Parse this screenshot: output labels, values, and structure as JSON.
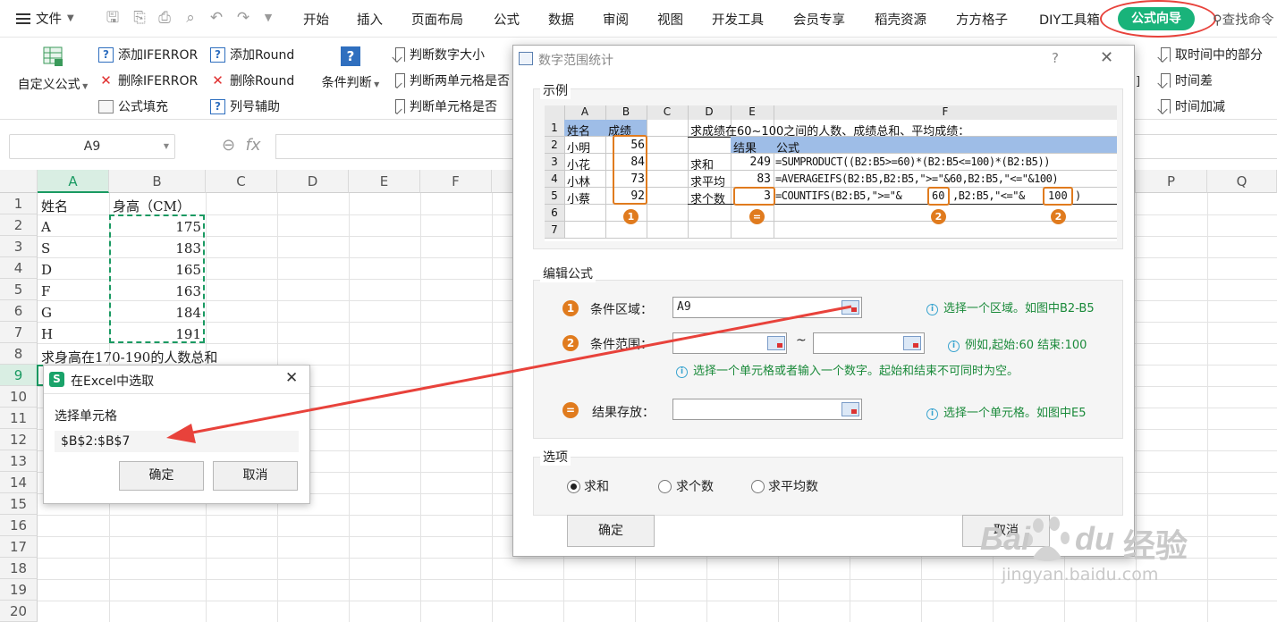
{
  "menubar": {
    "file": "文件",
    "tabs": [
      "开始",
      "插入",
      "页面布局",
      "公式",
      "数据",
      "审阅",
      "视图",
      "开发工具",
      "会员专享",
      "稻壳资源",
      "方方格子",
      "DIY工具箱"
    ],
    "active_tab": "公式向导",
    "search": "查找命令"
  },
  "ribbon": {
    "custom_formula": "自定义公式",
    "add_iferror": "添加IFERROR",
    "del_iferror": "删除IFERROR",
    "formula_fill": "公式填充",
    "add_round": "添加Round",
    "del_round": "删除Round",
    "col_assist": "列号辅助",
    "cond_judge": "条件判断",
    "judge_num": "判断数字大小",
    "judge_two": "判断两单元格是否",
    "judge_cell": "判断单元格是否",
    "time_part": "取时间中的部分",
    "time_diff": "时间差",
    "time_add": "时间加减"
  },
  "formulabar": {
    "namebox": "A9",
    "fx": "fx"
  },
  "sheet": {
    "columns": [
      "A",
      "B",
      "C",
      "D",
      "E",
      "F",
      "G",
      "H",
      "I",
      "J",
      "K",
      "L",
      "M",
      "N",
      "O",
      "P",
      "Q"
    ],
    "rows": [
      "1",
      "2",
      "3",
      "4",
      "5",
      "6",
      "7",
      "8",
      "9",
      "10",
      "11",
      "12",
      "13",
      "14",
      "15",
      "16",
      "17",
      "18",
      "19",
      "20"
    ],
    "header_a": "姓名",
    "header_b": "身高（CM）",
    "names": [
      "A",
      "S",
      "D",
      "F",
      "G",
      "H"
    ],
    "heights": [
      "175",
      "183",
      "165",
      "163",
      "184",
      "191"
    ],
    "note": "求身高在170-190的人数总和"
  },
  "pick_dialog": {
    "title": "在Excel中选取",
    "label": "选择单元格",
    "value": "$B$2:$B$7",
    "ok": "确定",
    "cancel": "取消"
  },
  "dialog": {
    "title": "数字范围统计",
    "help": "?",
    "example_label": "示例",
    "edit_label": "编辑公式",
    "options_label": "选项",
    "example": {
      "cols": [
        "A",
        "B",
        "C",
        "D",
        "E",
        "F"
      ],
      "rows": [
        "1",
        "2",
        "3",
        "4",
        "5",
        "6",
        "7"
      ],
      "h_name": "姓名",
      "h_score": "成绩",
      "names": [
        "小明",
        "小花",
        "小林",
        "小蔡"
      ],
      "scores": [
        "56",
        "84",
        "73",
        "92"
      ],
      "question": "求成绩在60~100之间的人数、成绩总和、平均成绩：",
      "h_result": "结果",
      "h_formula": "公式",
      "labels": [
        "求和",
        "求平均",
        "求个数"
      ],
      "results": [
        "249",
        "83",
        "3"
      ],
      "f1": "=SUMPRODUCT((B2:B5>=60)*(B2:B5<=100)*(B2:B5))",
      "f2": "=AVERAGEIFS(B2:B5,B2:B5,\">=\"&60,B2:B5,\"<=\"&100)",
      "f3a": "=COUNTIFS(B2:B5,\">=\"&",
      "f3b": "60",
      "f3c": ",B2:B5,\"<=\"&",
      "f3d": "100",
      "f3e": ")",
      "badge1": "1",
      "badge2": "2",
      "badge_eq": "="
    },
    "edit": {
      "cond_area_label": "条件区域：",
      "cond_area_value": "A9",
      "cond_area_info": "选择一个区域。如图中B2-B5",
      "cond_range_label": "条件范围：",
      "tilde": "~",
      "cond_range_info": "例如,起始:60 结束:100",
      "cond_range_info2": "选择一个单元格或者输入一个数字。起始和结束不可同时为空。",
      "result_label": "结果存放：",
      "result_info": "选择一个单元格。如图中E5"
    },
    "options": [
      "求和",
      "求个数",
      "求平均数"
    ],
    "ok": "确定",
    "cancel": "取消"
  },
  "watermark": {
    "brand": "Bai",
    "brand2": "du",
    "cn": "经验",
    "url": "jingyan.baidu.com"
  },
  "colors": {
    "accent": "#19b37a",
    "red": "#e8423b",
    "orange": "#e07b1e",
    "green": "#1a9a62"
  }
}
